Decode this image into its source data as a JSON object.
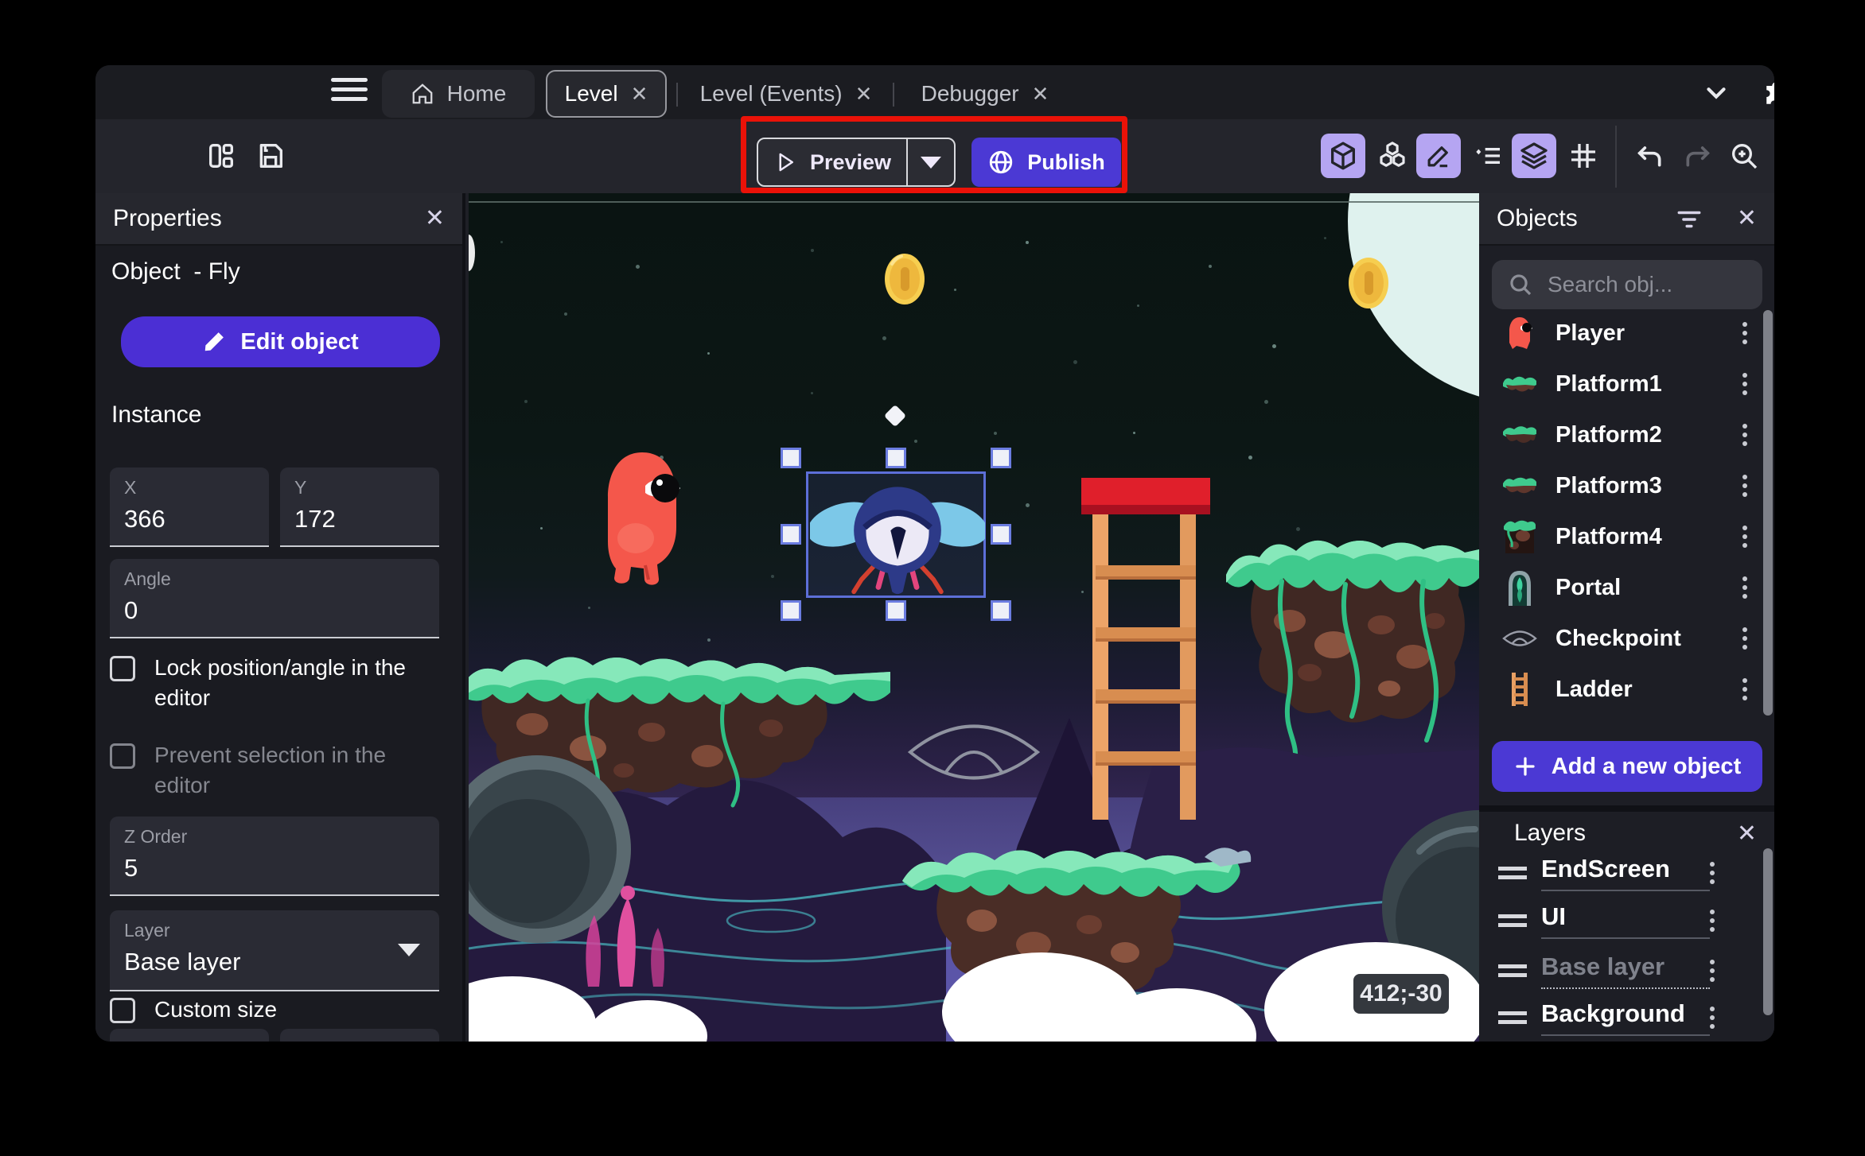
{
  "tabbar": {
    "tabs": [
      {
        "label": "Home"
      },
      {
        "label": "Level"
      },
      {
        "label": "Level (Events)"
      },
      {
        "label": "Debugger"
      }
    ]
  },
  "toolbar": {
    "preview": "Preview",
    "publish": "Publish"
  },
  "properties": {
    "title": "Properties",
    "object_label": "Object",
    "object_name": "- Fly",
    "edit_object": "Edit object",
    "section_instance": "Instance",
    "x_label": "X",
    "x_value": "366",
    "y_label": "Y",
    "y_value": "172",
    "angle_label": "Angle",
    "angle_value": "0",
    "lock_label": "Lock position/angle in the editor",
    "prevent_label": "Prevent selection in the editor",
    "zorder_label": "Z Order",
    "zorder_value": "5",
    "layer_label": "Layer",
    "layer_value": "Base layer",
    "custom_size_label": "Custom size"
  },
  "canvas": {
    "coords_badge": "412;-30"
  },
  "objects": {
    "title": "Objects",
    "search_placeholder": "Search obj...",
    "items": [
      {
        "name": "Player"
      },
      {
        "name": "Platform1"
      },
      {
        "name": "Platform2"
      },
      {
        "name": "Platform3"
      },
      {
        "name": "Platform4"
      },
      {
        "name": "Portal"
      },
      {
        "name": "Checkpoint"
      },
      {
        "name": "Ladder"
      }
    ],
    "add_button": "Add a new object"
  },
  "layers": {
    "title": "Layers",
    "items": [
      {
        "name": "EndScreen"
      },
      {
        "name": "UI"
      },
      {
        "name": "Base layer"
      },
      {
        "name": "Background"
      }
    ]
  },
  "icons": {
    "close": "✕"
  },
  "colors": {
    "accent_purple": "#4b39d4",
    "annotation_red": "#ea1208",
    "selection_blue": "#5d6fd8",
    "toolbar_highlight": "#b5a5f2"
  }
}
